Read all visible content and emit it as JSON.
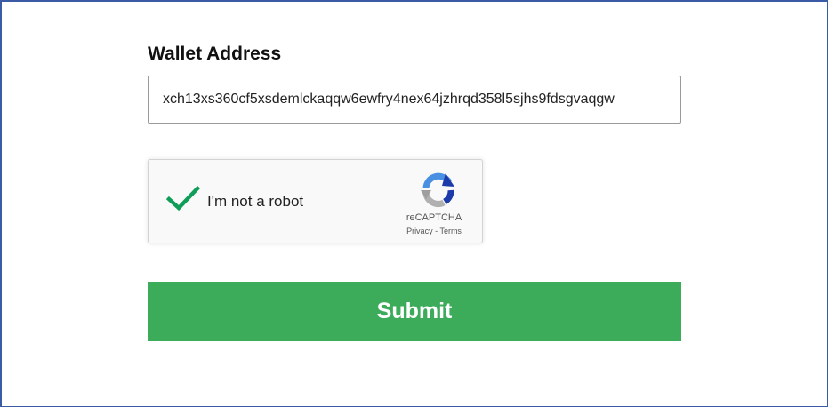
{
  "form": {
    "wallet_label": "Wallet Address",
    "wallet_value": "xch13xs360cf5xsdemlckaqqw6ewfry4nex64jzhrqd358l5sjhs9fdsgvaqgw",
    "submit_label": "Submit"
  },
  "recaptcha": {
    "checked": true,
    "label": "I'm not a robot",
    "brand": "reCAPTCHA",
    "privacy": "Privacy",
    "separator": "-",
    "terms": "Terms"
  },
  "colors": {
    "frame_border": "#3b5ba5",
    "submit_bg": "#3cab5a",
    "checkmark": "#0f9d58"
  },
  "icons": {
    "check": "checkmark-icon",
    "recaptcha_logo": "recaptcha-logo-icon"
  }
}
